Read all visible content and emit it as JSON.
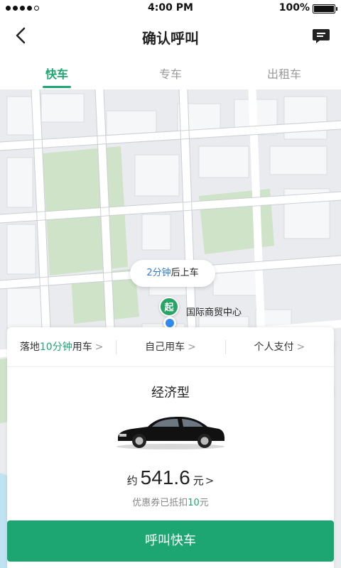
{
  "status_bar": {
    "time": "4:00 PM",
    "battery": "100%",
    "battery_level": 1.0
  },
  "header": {
    "title": "确认呼叫",
    "back_icon": "chevron-left-icon",
    "message_icon": "message-icon"
  },
  "tabs": [
    {
      "label": "快车",
      "active": true
    },
    {
      "label": "专车",
      "active": false
    },
    {
      "label": "出租车",
      "active": false
    }
  ],
  "map": {
    "eta_number": "2分钟",
    "eta_suffix": "后上车",
    "start_pin_label": "起",
    "place_name": "国际商贸中心",
    "safety_icon": "shield-plus-icon",
    "locate_icon": "crosshair-icon"
  },
  "options": {
    "time": {
      "prefix": "落地",
      "highlight": "10分钟",
      "suffix": "用车"
    },
    "rider": "自己用车",
    "payment": "个人支付",
    "chevron": ">"
  },
  "car": {
    "type": "经济型",
    "image_icon": "car-icon"
  },
  "price": {
    "prefix": "约",
    "value": "541.6",
    "unit": "元",
    "chevron": ">"
  },
  "coupon": {
    "prefix": "优惠券已抵扣",
    "amount": "10",
    "unit": "元"
  },
  "call_button": "呼叫快车",
  "colors": {
    "accent": "#1ea672",
    "eta_blue": "#2f7ad6",
    "location_blue": "#2f8af0"
  }
}
